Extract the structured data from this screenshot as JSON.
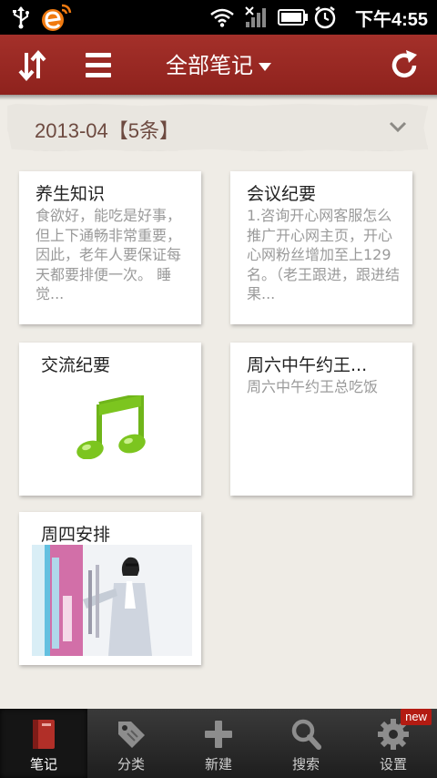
{
  "status_bar": {
    "time": "下午4:55",
    "icons": [
      "usb-icon",
      "app-notification-icon",
      "wifi-icon",
      "no-signal-icon",
      "battery-icon",
      "alarm-icon"
    ]
  },
  "header": {
    "title": "全部笔记",
    "left_icons": [
      "sort-icon",
      "list-menu-icon"
    ],
    "right_icon": "refresh-icon",
    "color": "#9a2923"
  },
  "date_group": {
    "label": "2013-04【5条】"
  },
  "notes": [
    {
      "title": "养生知识",
      "preview": "食欲好，能吃是好事，但上下通畅非常重要，因此，老年人要保证每天都要排便一次。 睡觉...",
      "kind": "text"
    },
    {
      "title": "会议纪要",
      "preview": "1.咨询开心网客服怎么推广开心网主页，开心心网粉丝增加至上129名。（老王跟进，跟进结果...",
      "kind": "text"
    },
    {
      "title": "交流纪要",
      "preview": "",
      "kind": "audio",
      "icon": "music-note-icon"
    },
    {
      "title": "周六中午约王...",
      "preview": "周六中午约王总吃饭",
      "kind": "text"
    },
    {
      "title": "周四安排",
      "preview": "",
      "kind": "image"
    }
  ],
  "tabs": [
    {
      "label": "笔记",
      "icon": "notebook-icon",
      "active": true
    },
    {
      "label": "分类",
      "icon": "tag-icon",
      "active": false
    },
    {
      "label": "新建",
      "icon": "plus-icon",
      "active": false
    },
    {
      "label": "搜索",
      "icon": "search-icon",
      "active": false
    },
    {
      "label": "设置",
      "icon": "gear-icon",
      "active": false,
      "badge": "new"
    }
  ],
  "colors": {
    "accent": "#9a2923",
    "badge": "#b31b12",
    "music_green": "#7cc51f"
  }
}
